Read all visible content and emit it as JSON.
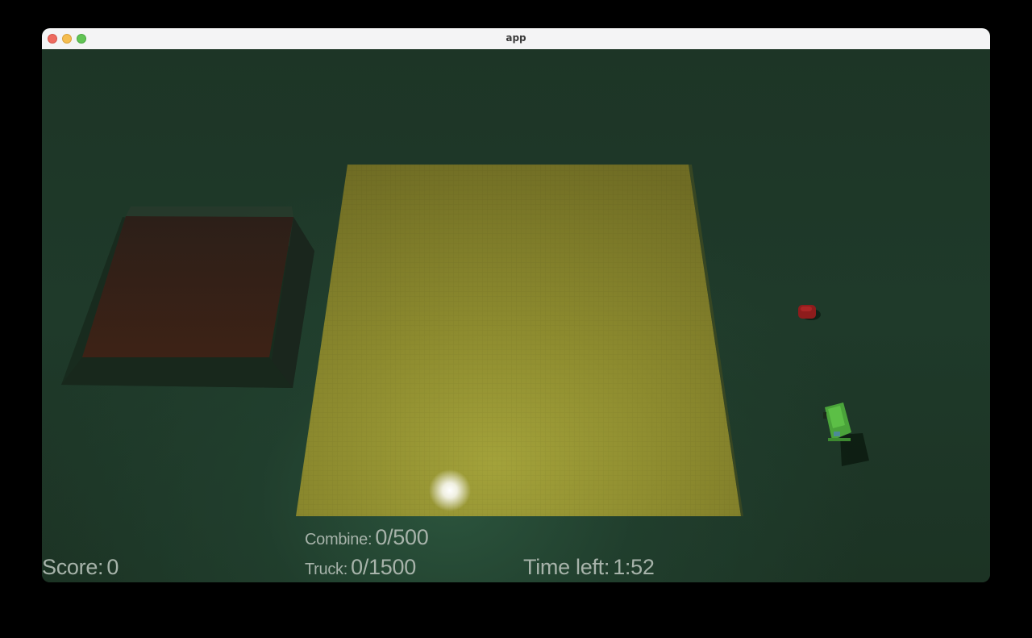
{
  "window": {
    "title": "app"
  },
  "hud": {
    "score_label": "Score:",
    "score_value": "0",
    "combine_label": "Combine:",
    "combine_value": "0/500",
    "truck_label": "Truck:",
    "truck_value": "0/1500",
    "time_label": "Time left:",
    "time_value": "1:52"
  },
  "colors": {
    "ground": "#1c3324",
    "field": "#8a8a2c",
    "barn": "#3a2418",
    "combine": "#4aa33a",
    "truck": "#8e1c1c",
    "hud_text": "#a7b3aa"
  }
}
